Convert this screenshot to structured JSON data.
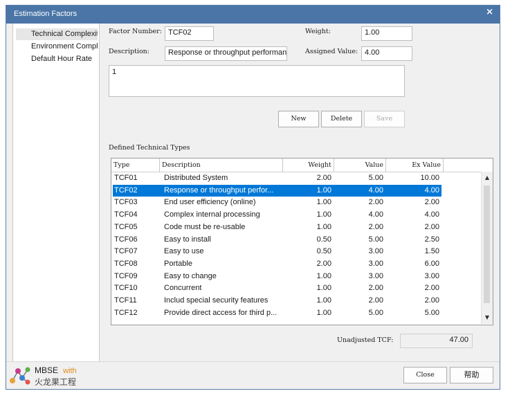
{
  "window": {
    "title": "Estimation Factors",
    "close_glyph": "×"
  },
  "nav": {
    "items": [
      {
        "label": "Technical Complexity Factors",
        "selected": true
      },
      {
        "label": "Environment Complexity Factors",
        "selected": false
      },
      {
        "label": "Default Hour Rate",
        "selected": false
      }
    ]
  },
  "form": {
    "factor_number_label": "Factor Number:",
    "factor_number_value": "TCF02",
    "weight_label": "Weight:",
    "weight_value": "1.00",
    "description_label": "Description:",
    "description_value": "Response or throughput performance",
    "assigned_value_label": "Assigned Value:",
    "assigned_value_value": "4.00",
    "notes_value": "1"
  },
  "buttons": {
    "new": "New",
    "delete": "Delete",
    "save": "Save",
    "close": "Close",
    "help": "帮助"
  },
  "table": {
    "caption": "Defined Technical Types",
    "headers": [
      "Type",
      "Description",
      "Weight",
      "Value",
      "Ex Value"
    ],
    "rows": [
      [
        "TCF01",
        "Distributed System",
        "2.00",
        "5.00",
        "10.00"
      ],
      [
        "TCF02",
        "Response or throughput perfor...",
        "1.00",
        "4.00",
        "4.00"
      ],
      [
        "TCF03",
        "End user efficiency (online)",
        "1.00",
        "2.00",
        "2.00"
      ],
      [
        "TCF04",
        "Complex internal processing",
        "1.00",
        "4.00",
        "4.00"
      ],
      [
        "TCF05",
        "Code must be re-usable",
        "1.00",
        "2.00",
        "2.00"
      ],
      [
        "TCF06",
        "Easy to install",
        "0.50",
        "5.00",
        "2.50"
      ],
      [
        "TCF07",
        "Easy to use",
        "0.50",
        "3.00",
        "1.50"
      ],
      [
        "TCF08",
        "Portable",
        "2.00",
        "3.00",
        "6.00"
      ],
      [
        "TCF09",
        "Easy to change",
        "1.00",
        "3.00",
        "3.00"
      ],
      [
        "TCF10",
        "Concurrent",
        "1.00",
        "2.00",
        "2.00"
      ],
      [
        "TCF11",
        "Includ special security features",
        "1.00",
        "2.00",
        "2.00"
      ],
      [
        "TCF12",
        "Provide direct access for third p...",
        "1.00",
        "5.00",
        "5.00"
      ]
    ],
    "selected_row": 1
  },
  "summary": {
    "label": "Unadjusted TCF:",
    "value": "47.00"
  },
  "logo": {
    "line1": "MBSE",
    "line1_suffix": "with",
    "line2": "火龙果工程"
  }
}
